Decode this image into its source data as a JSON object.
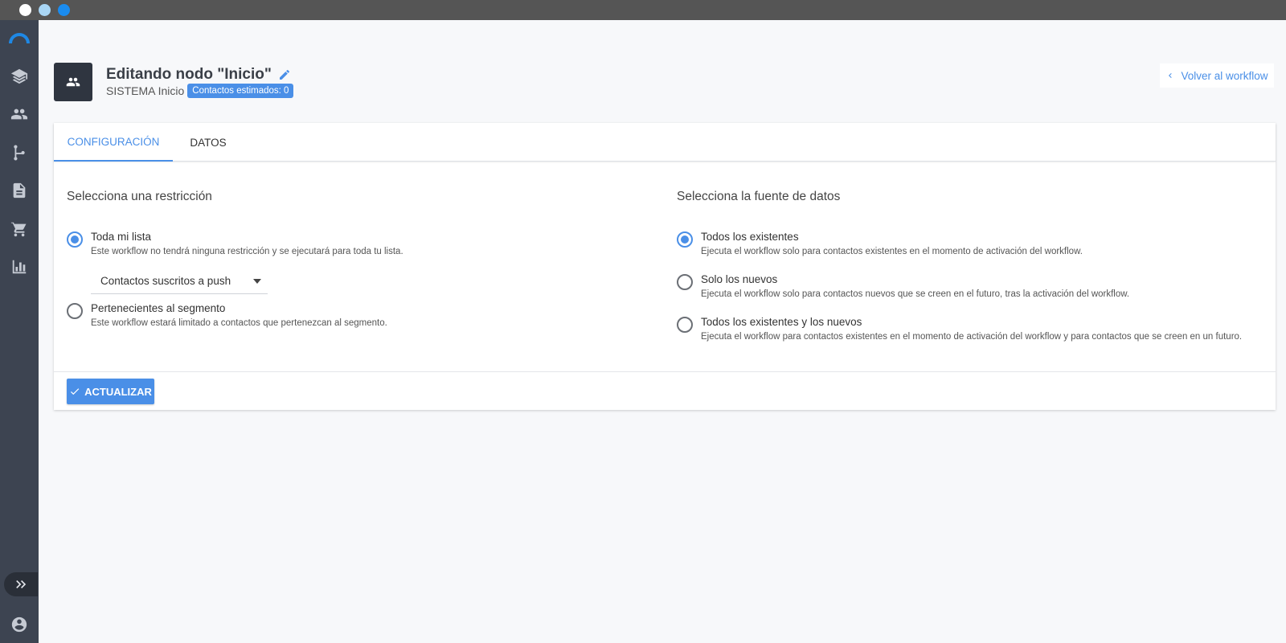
{
  "header": {
    "title": "Editando nodo \"Inicio\"",
    "system_label": "SISTEMA Inicio",
    "contacts_badge": "Contactos estimados: 0",
    "back_label": "Volver al workflow"
  },
  "tabs": [
    {
      "label": "CONFIGURACIÓN",
      "active": true
    },
    {
      "label": "DATOS",
      "active": false
    }
  ],
  "restriction": {
    "title": "Selecciona una restricción",
    "options": [
      {
        "label": "Toda mi lista",
        "description": "Este workflow no tendrá ninguna restricción y se ejecutará para toda tu lista.",
        "checked": true
      },
      {
        "label": "Pertenecientes al segmento",
        "description": "Este workflow estará limitado a contactos que pertenezcan al segmento.",
        "checked": false
      }
    ],
    "select_value": "Contactos suscritos a push"
  },
  "source": {
    "title": "Selecciona la fuente de datos",
    "options": [
      {
        "label": "Todos los existentes",
        "description": "Ejecuta el workflow solo para contactos existentes en el momento de activación del workflow.",
        "checked": true
      },
      {
        "label": "Solo los nuevos",
        "description": "Ejecuta el workflow solo para contactos nuevos que se creen en el futuro, tras la activación del workflow.",
        "checked": false
      },
      {
        "label": "Todos los existentes y los nuevos",
        "description": "Ejecuta el workflow para contactos existentes en el momento de activación del workflow y para contactos que se creen en un futuro.",
        "checked": false
      }
    ]
  },
  "actions": {
    "update_label": "ACTUALIZAR"
  },
  "sidebar": {
    "icons": [
      "logo-icon",
      "layers-icon",
      "people-icon",
      "flow-icon",
      "document-icon",
      "cart-icon",
      "chart-icon",
      "expand-icon",
      "account-icon"
    ]
  },
  "colors": {
    "accent": "#4a8fe7",
    "sidebar": "#3d4451",
    "window_bar": "#555555"
  }
}
